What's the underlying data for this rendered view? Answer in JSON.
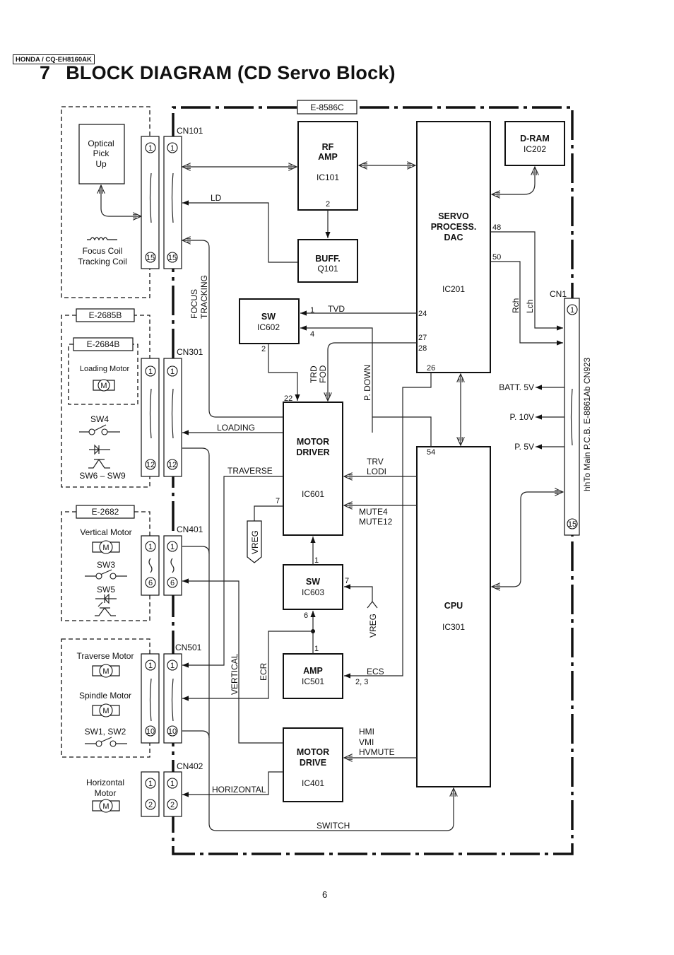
{
  "header": {
    "model_tag": "HONDA / CQ-EH8160AK",
    "section_number": "7",
    "title": "BLOCK DIAGRAM (CD Servo Block)"
  },
  "page_number": "6",
  "boards": {
    "main": "E-8586C",
    "loading_outer": "E-2685B",
    "loading_inner": "E-2684B",
    "vertical": "E-2682"
  },
  "connectors": {
    "cn101": {
      "label": "CN101",
      "pin_first": "1",
      "pin_last": "15"
    },
    "cn301": {
      "label": "CN301",
      "pin_first": "1",
      "pin_last": "12"
    },
    "cn401": {
      "label": "CN401",
      "pin_first": "1",
      "pin_last": "6"
    },
    "cn501": {
      "label": "CN501",
      "pin_first": "1",
      "pin_last": "10"
    },
    "cn402": {
      "label": "CN402",
      "pin_first": "1",
      "pin_last": "2"
    },
    "cn1": {
      "label": "CN1",
      "pin_first": "1",
      "pin_last": "15",
      "description": "hhTo Main P.C.B. E-8861Ab CN923"
    }
  },
  "blocks": {
    "rf_amp": {
      "name_line1": "RF",
      "name_line2": "AMP",
      "ic": "IC101",
      "pin": "2"
    },
    "buff": {
      "name": "BUFF.",
      "ic": "Q101"
    },
    "servo": {
      "name_line1": "SERVO",
      "name_line2": "PROCESS.",
      "name_line3": "DAC",
      "ic": "IC201",
      "pins": {
        "p48": "48",
        "p50": "50",
        "p24": "24",
        "p27": "27",
        "p28": "28",
        "p26": "26"
      }
    },
    "dram": {
      "name": "D-RAM",
      "ic": "IC202"
    },
    "sw602": {
      "name": "SW",
      "ic": "IC602",
      "pins": {
        "p1": "1",
        "p4": "4",
        "p2": "2"
      }
    },
    "motor_driver": {
      "name_line1": "MOTOR",
      "name_line2": "DRIVER",
      "ic": "IC601",
      "pins": {
        "p22": "22",
        "p7": "7",
        "p1": "1"
      }
    },
    "sw603": {
      "name": "SW",
      "ic": "IC603",
      "pins": {
        "p7": "7",
        "p6": "6"
      }
    },
    "amp501": {
      "name": "AMP",
      "ic": "IC501",
      "pins": {
        "p1": "1",
        "p23": "2, 3"
      }
    },
    "motor_drive": {
      "name_line1": "MOTOR",
      "name_line2": "DRIVE",
      "ic": "IC401"
    },
    "cpu": {
      "name": "CPU",
      "ic": "IC301",
      "pin": "54"
    }
  },
  "components": {
    "optical_pickup": {
      "line1": "Optical",
      "line2": "Pick",
      "line3": "Up"
    },
    "coils": {
      "line1": "Focus Coil",
      "line2": "Tracking Coil"
    },
    "loading_motor": "Loading Motor",
    "sw4": "SW4",
    "sw6_9": "SW6 – SW9",
    "vertical_motor": "Vertical Motor",
    "sw3": "SW3",
    "sw5": "SW5",
    "traverse_motor": "Traverse Motor",
    "spindle_motor": "Spindle Motor",
    "sw1_2": "SW1, SW2",
    "horizontal_motor": {
      "line1": "Horizontal",
      "line2": "Motor"
    },
    "motor_symbol": "M"
  },
  "signals": {
    "ld": "LD",
    "focus": "FOCUS",
    "tracking": "TRACKING",
    "tvd": "TVD",
    "trd": "TRD",
    "fod": "FOD",
    "p_down": "P. DOWN",
    "loading": "LOADING",
    "traverse": "TRAVERSE",
    "vreg": "VREG",
    "trv": "TRV",
    "lodi": "LODI",
    "mute4": "MUTE4",
    "mute12": "MUTE12",
    "ecr": "ECR",
    "ecs": "ECS",
    "vertical": "VERTICAL",
    "horizontal": "HORIZONTAL",
    "hmi": "HMI",
    "vmi": "VMI",
    "hvmute": "HVMUTE",
    "switch": "SWITCH",
    "rch": "Rch",
    "lch": "Lch",
    "batt5v": "BATT. 5V",
    "p10v": "P. 10V",
    "p5v": "P. 5V"
  }
}
